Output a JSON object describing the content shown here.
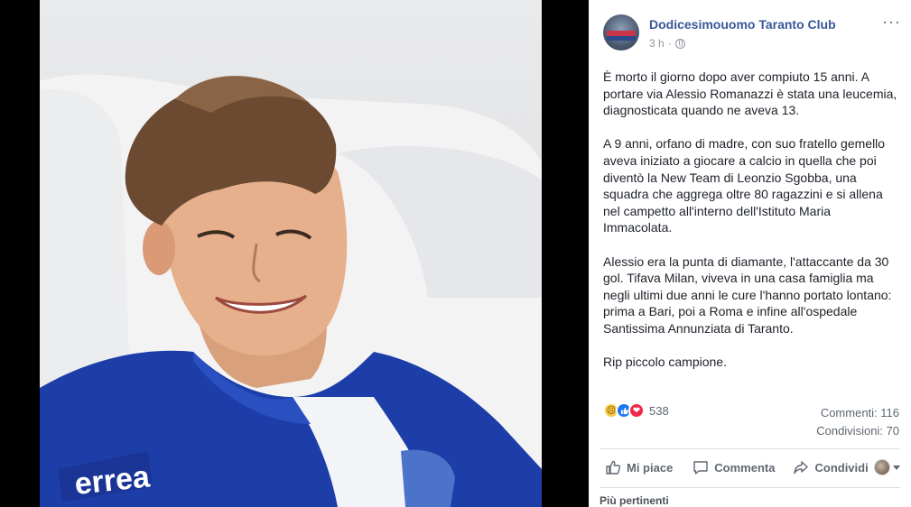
{
  "post": {
    "page_name": "Dodicesimouomo Taranto Club",
    "time": "3 h",
    "more_label": "···",
    "paragraphs": [
      "È morto il giorno dopo aver compiuto 15 anni. A portare via Alessio Romanazzi è stata una leucemia, diagnosticata quando ne aveva 13.",
      "A 9 anni, orfano di madre, con suo fratello gemello aveva iniziato a giocare a calcio in quella che poi diventò la New Team di Leonzio Sgobba, una squadra che aggrega oltre 80 ragazzini e si allena nel campetto all'interno dell'Istituto Maria Immacolata.",
      "Alessio era la punta di diamante, l'attaccante da 30 gol. Tifava Milan, viveva in una casa famiglia ma negli ultimi due anni le cure l'hanno portato lontano: prima a Bari, poi a Roma e infine all'ospedale Santissima Annunziata di Taranto.",
      "Rip piccolo campione."
    ]
  },
  "reactions": {
    "icons": [
      "sad-icon",
      "like-icon",
      "love-icon"
    ],
    "count": "538",
    "comments": "Commenti: 116",
    "shares": "Condivisioni: 70"
  },
  "actions": {
    "like": "Mi piace",
    "comment": "Commenta",
    "share": "Condividi"
  },
  "footer": {
    "more_comments": "Più pertinenti"
  },
  "colors": {
    "link_blue": "#385898",
    "like_blue": "#1877f2",
    "love_red": "#f0284a",
    "sad_yellow": "#f7c843"
  }
}
